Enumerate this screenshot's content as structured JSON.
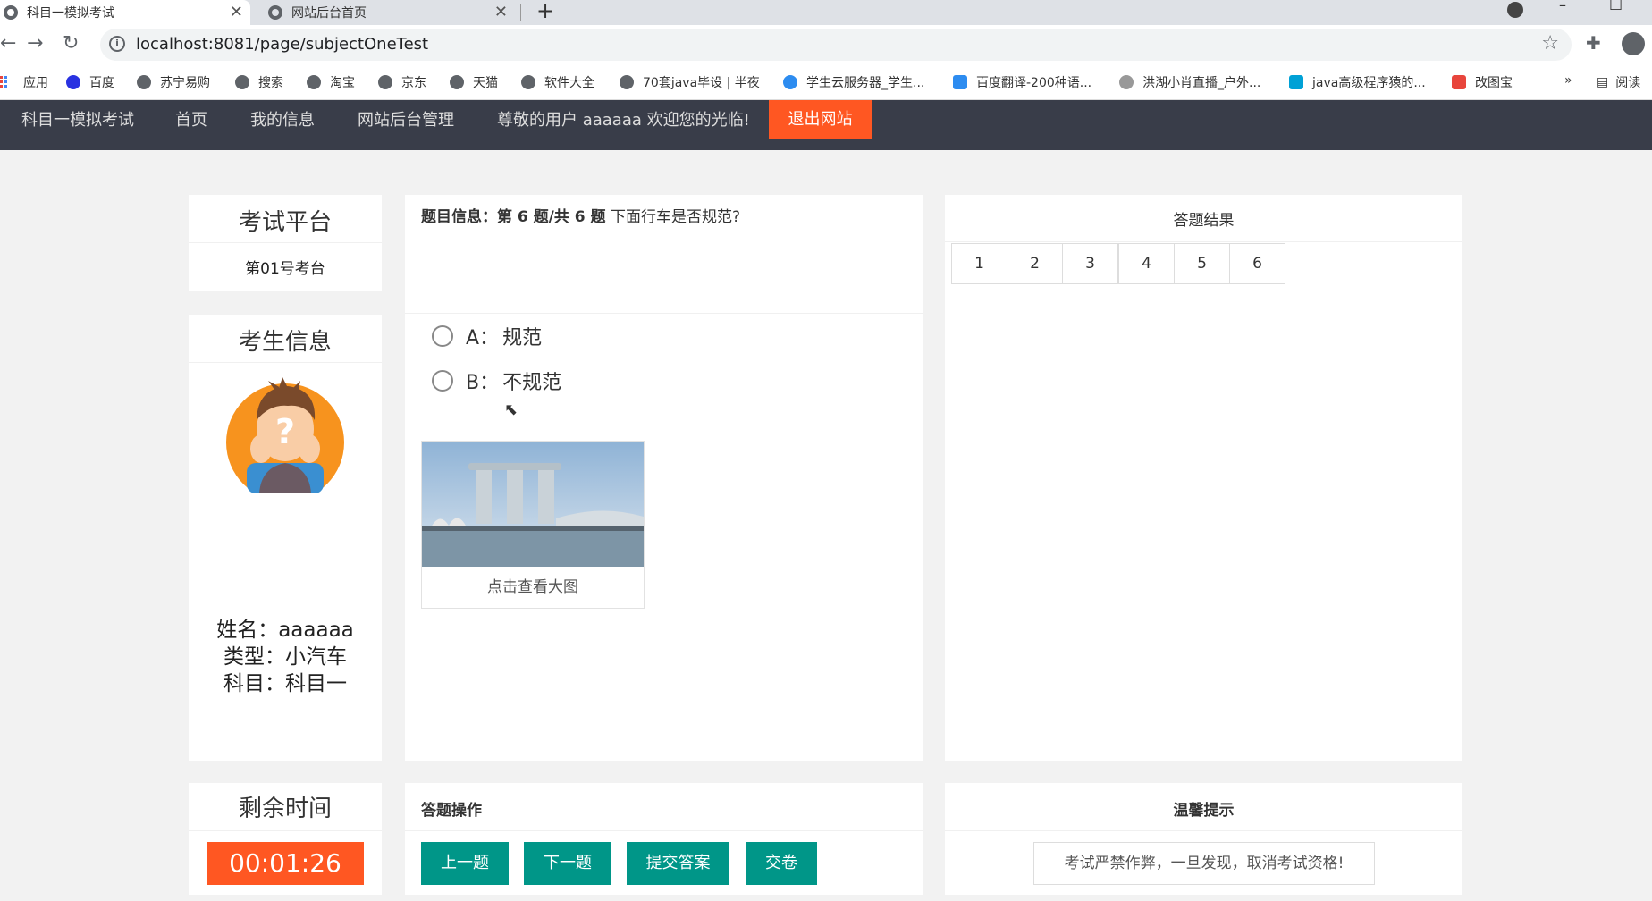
{
  "browser": {
    "tabs": [
      {
        "title": "科目一模拟考试",
        "active": true
      },
      {
        "title": "网站后台首页",
        "active": false
      }
    ],
    "new_tab_icon": "+",
    "url": "localhost:8081/page/subjectOneTest",
    "bookmarks": [
      {
        "label": "应用",
        "icon": "apps-grid-icon"
      },
      {
        "label": "百度",
        "icon": "baidu-paw-icon"
      },
      {
        "label": "苏宁易购",
        "icon": "globe-icon"
      },
      {
        "label": "搜索",
        "icon": "globe-icon"
      },
      {
        "label": "淘宝",
        "icon": "globe-icon"
      },
      {
        "label": "京东",
        "icon": "globe-icon"
      },
      {
        "label": "天猫",
        "icon": "globe-icon"
      },
      {
        "label": "软件大全",
        "icon": "globe-icon"
      },
      {
        "label": "70套java毕设 | 半夜",
        "icon": "globe-icon"
      },
      {
        "label": "学生云服务器_学生...",
        "icon": "cloud-icon"
      },
      {
        "label": "百度翻译-200种语...",
        "icon": "translate-icon"
      },
      {
        "label": "洪湖小肖直播_户外...",
        "icon": "bird-icon"
      },
      {
        "label": "java高级程序猿的...",
        "icon": "bilibili-icon"
      },
      {
        "label": "改图宝",
        "icon": "office-icon"
      }
    ],
    "bookmarks_more": "»",
    "reading_list": "阅读"
  },
  "nav": {
    "items": [
      "科目一模拟考试",
      "首页",
      "我的信息",
      "网站后台管理",
      "尊敬的用户 aaaaaa 欢迎您的光临!"
    ],
    "logout": "退出网站"
  },
  "platform": {
    "title": "考试平台",
    "seat": "第01号考台"
  },
  "student": {
    "title": "考生信息",
    "name_line": "姓名：aaaaaa",
    "type_line": "类型：小汽车",
    "subject_line": "科目：科目一"
  },
  "question": {
    "label": "题目信息：",
    "progress": "第 6 题/共 6 题",
    "text": "下面行车是否规范?",
    "options": [
      {
        "key": "A：",
        "text": "规范"
      },
      {
        "key": "B：",
        "text": "不规范"
      }
    ],
    "image_caption": "点击查看大图"
  },
  "results": {
    "title": "答题结果",
    "numbers": [
      "1",
      "2",
      "3",
      "4",
      "5",
      "6"
    ]
  },
  "timer": {
    "title": "剩余时间",
    "value": "00:01:26"
  },
  "operations": {
    "title": "答题操作",
    "buttons": [
      "上一题",
      "下一题",
      "提交答案",
      "交卷"
    ]
  },
  "tips": {
    "title": "温馨提示",
    "text": "考试严禁作弊，一旦发现，取消考试资格!"
  },
  "colors": {
    "nav_bg": "#393d49",
    "accent_orange": "#ff5722",
    "accent_teal": "#009688"
  }
}
